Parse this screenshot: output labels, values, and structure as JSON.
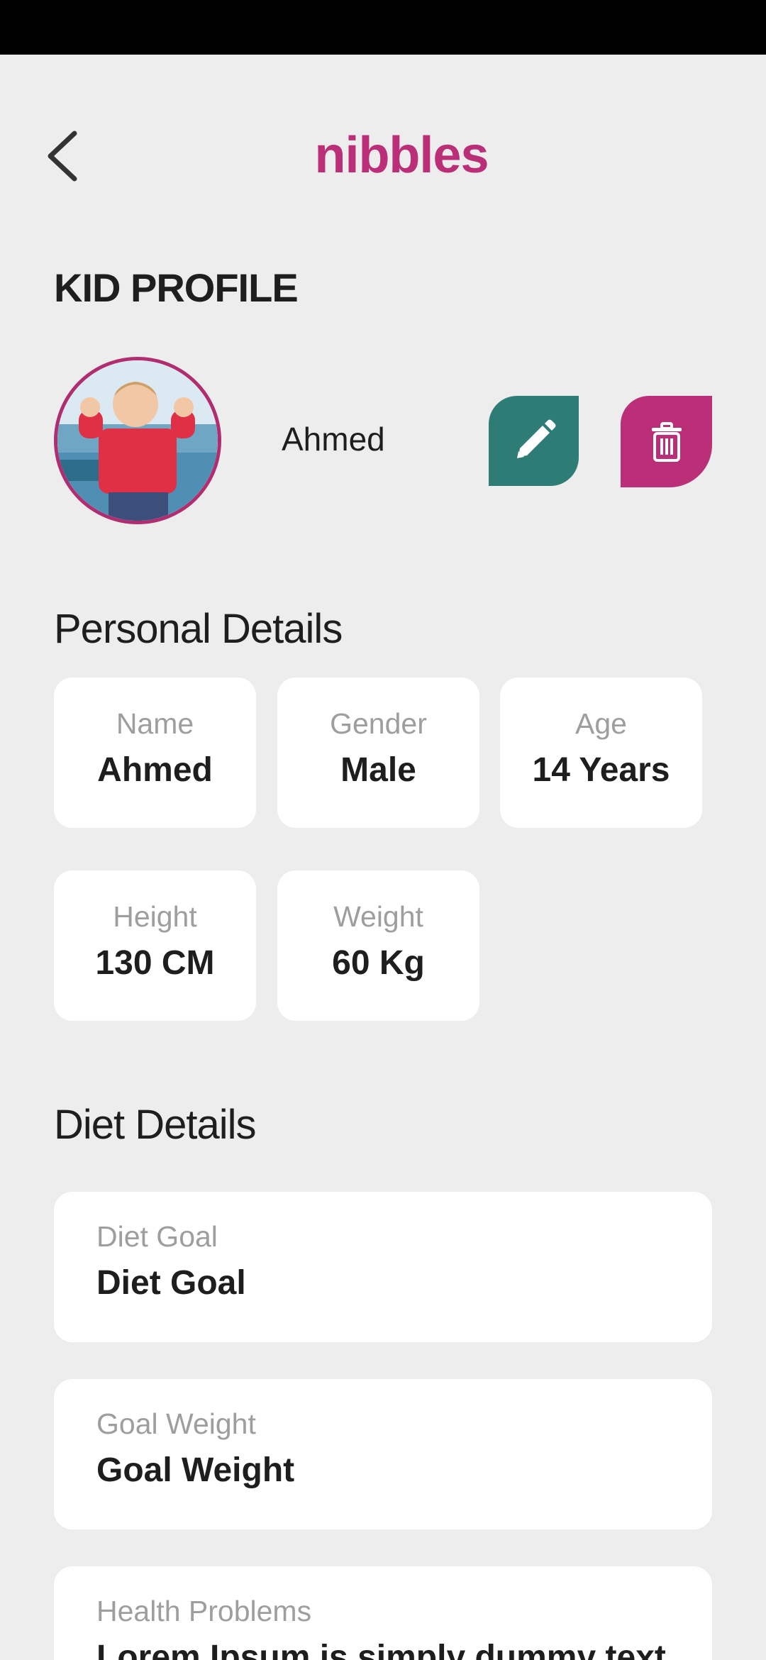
{
  "header": {
    "logo": "nibbles",
    "page_title": "KID PROFILE"
  },
  "profile": {
    "name": "Ahmed"
  },
  "personal": {
    "title": "Personal Details",
    "fields": [
      {
        "label": "Name",
        "value": "Ahmed"
      },
      {
        "label": "Gender",
        "value": "Male"
      },
      {
        "label": "Age",
        "value": "14 Years"
      },
      {
        "label": "Height",
        "value": "130 CM"
      },
      {
        "label": "Weight",
        "value": "60 Kg"
      }
    ]
  },
  "diet": {
    "title": "Diet Details",
    "fields": [
      {
        "label": "Diet Goal",
        "value": "Diet Goal"
      },
      {
        "label": "Goal Weight",
        "value": "Goal Weight"
      },
      {
        "label": "Health Problems",
        "value": "Lorem Ipsum is simply dummy text"
      }
    ]
  },
  "colors": {
    "brand": "#bb2f78",
    "edit": "#2e7c76",
    "background": "#ededed"
  },
  "icons": [
    "back-chevron-icon",
    "pencil-icon",
    "trash-icon"
  ]
}
